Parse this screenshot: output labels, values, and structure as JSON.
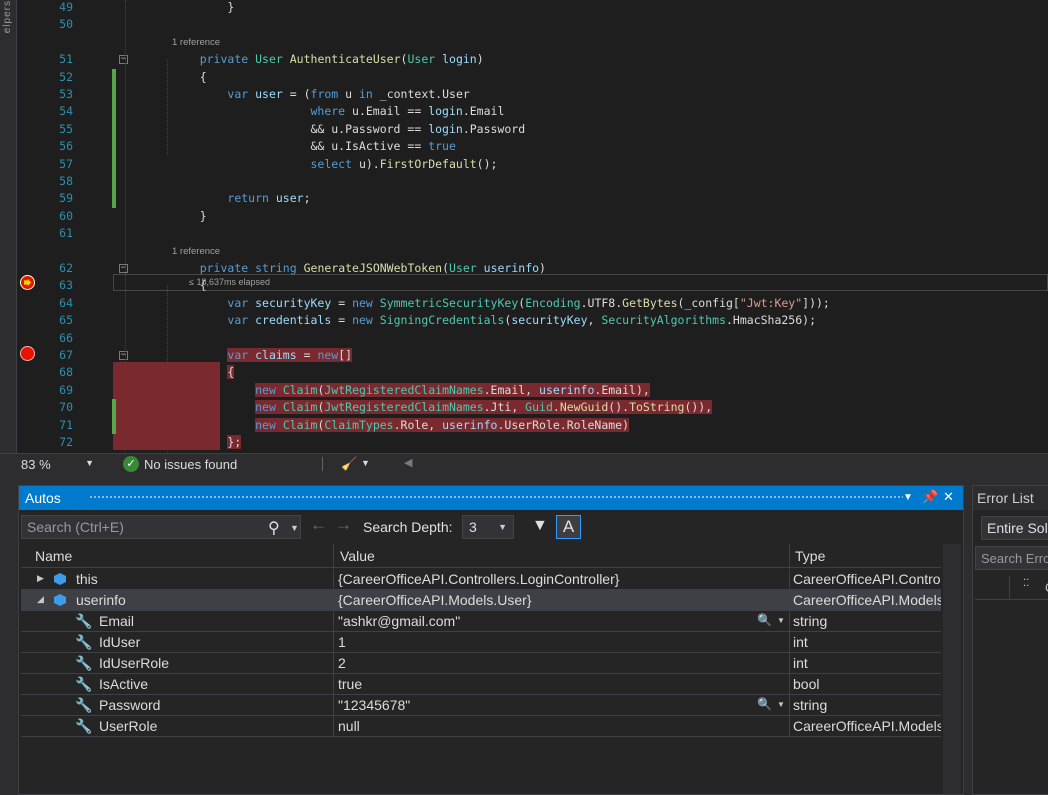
{
  "editor": {
    "left_strip_label": "elpers",
    "perf_tip": "≤ 18,637ms elapsed",
    "lines": [
      {
        "n": "49",
        "segs": [
          {
            "t": "        }",
            "c": ""
          }
        ]
      },
      {
        "n": "50",
        "segs": []
      },
      {
        "ref": "1 reference"
      },
      {
        "n": "51",
        "segs": [
          {
            "t": "    ",
            "c": ""
          },
          {
            "t": "private",
            "c": "kw"
          },
          {
            "t": " ",
            "c": ""
          },
          {
            "t": "User",
            "c": "ty"
          },
          {
            "t": " ",
            "c": ""
          },
          {
            "t": "AuthenticateUser",
            "c": "fn"
          },
          {
            "t": "(",
            "c": ""
          },
          {
            "t": "User",
            "c": "ty"
          },
          {
            "t": " ",
            "c": ""
          },
          {
            "t": "login",
            "c": "vr"
          },
          {
            "t": ")",
            "c": ""
          }
        ]
      },
      {
        "n": "52",
        "segs": [
          {
            "t": "    {",
            "c": ""
          }
        ]
      },
      {
        "n": "53",
        "segs": [
          {
            "t": "        ",
            "c": ""
          },
          {
            "t": "var",
            "c": "kw"
          },
          {
            "t": " ",
            "c": ""
          },
          {
            "t": "user",
            "c": "vr"
          },
          {
            "t": " = (",
            "c": ""
          },
          {
            "t": "from",
            "c": "kw"
          },
          {
            "t": " u ",
            "c": ""
          },
          {
            "t": "in",
            "c": "kw"
          },
          {
            "t": " _context.User",
            "c": ""
          }
        ]
      },
      {
        "n": "54",
        "segs": [
          {
            "t": "                    ",
            "c": ""
          },
          {
            "t": "where",
            "c": "kw"
          },
          {
            "t": " u.Email == ",
            "c": ""
          },
          {
            "t": "login",
            "c": "vr"
          },
          {
            "t": ".Email",
            "c": ""
          }
        ]
      },
      {
        "n": "55",
        "segs": [
          {
            "t": "                    && u.Password == ",
            "c": ""
          },
          {
            "t": "login",
            "c": "vr"
          },
          {
            "t": ".Password",
            "c": ""
          }
        ]
      },
      {
        "n": "56",
        "segs": [
          {
            "t": "                    && u.IsActive == ",
            "c": ""
          },
          {
            "t": "true",
            "c": "kw"
          }
        ]
      },
      {
        "n": "57",
        "segs": [
          {
            "t": "                    ",
            "c": ""
          },
          {
            "t": "select",
            "c": "kw"
          },
          {
            "t": " u).",
            "c": ""
          },
          {
            "t": "FirstOrDefault",
            "c": "fn"
          },
          {
            "t": "();",
            "c": ""
          }
        ]
      },
      {
        "n": "58",
        "segs": []
      },
      {
        "n": "59",
        "segs": [
          {
            "t": "        ",
            "c": ""
          },
          {
            "t": "return",
            "c": "kw"
          },
          {
            "t": " ",
            "c": ""
          },
          {
            "t": "user",
            "c": "vr"
          },
          {
            "t": ";",
            "c": ""
          }
        ]
      },
      {
        "n": "60",
        "segs": [
          {
            "t": "    }",
            "c": ""
          }
        ]
      },
      {
        "n": "61",
        "segs": []
      },
      {
        "ref": "1 reference"
      },
      {
        "n": "62",
        "segs": [
          {
            "t": "    ",
            "c": ""
          },
          {
            "t": "private",
            "c": "kw"
          },
          {
            "t": " ",
            "c": ""
          },
          {
            "t": "string",
            "c": "kw"
          },
          {
            "t": " ",
            "c": ""
          },
          {
            "t": "GenerateJSONWebToken",
            "c": "fn"
          },
          {
            "t": "(",
            "c": ""
          },
          {
            "t": "User",
            "c": "ty"
          },
          {
            "t": " ",
            "c": ""
          },
          {
            "t": "userinfo",
            "c": "vr"
          },
          {
            "t": ")",
            "c": ""
          }
        ]
      },
      {
        "n": "63",
        "segs": [
          {
            "t": "    {",
            "c": ""
          }
        ]
      },
      {
        "n": "64",
        "segs": [
          {
            "t": "        ",
            "c": ""
          },
          {
            "t": "var",
            "c": "kw"
          },
          {
            "t": " ",
            "c": ""
          },
          {
            "t": "securityKey",
            "c": "vr"
          },
          {
            "t": " = ",
            "c": ""
          },
          {
            "t": "new",
            "c": "kw"
          },
          {
            "t": " ",
            "c": ""
          },
          {
            "t": "SymmetricSecurityKey",
            "c": "ty"
          },
          {
            "t": "(",
            "c": ""
          },
          {
            "t": "Encoding",
            "c": "ty"
          },
          {
            "t": ".UTF8.",
            "c": ""
          },
          {
            "t": "GetBytes",
            "c": "fn"
          },
          {
            "t": "(_config[",
            "c": ""
          },
          {
            "t": "\"Jwt:Key\"",
            "c": "st"
          },
          {
            "t": "]));",
            "c": ""
          }
        ]
      },
      {
        "n": "65",
        "segs": [
          {
            "t": "        ",
            "c": ""
          },
          {
            "t": "var",
            "c": "kw"
          },
          {
            "t": " ",
            "c": ""
          },
          {
            "t": "credentials",
            "c": "vr"
          },
          {
            "t": " = ",
            "c": ""
          },
          {
            "t": "new",
            "c": "kw"
          },
          {
            "t": " ",
            "c": ""
          },
          {
            "t": "SigningCredentials",
            "c": "ty"
          },
          {
            "t": "(",
            "c": ""
          },
          {
            "t": "securityKey",
            "c": "vr"
          },
          {
            "t": ", ",
            "c": ""
          },
          {
            "t": "SecurityAlgorithms",
            "c": "ty"
          },
          {
            "t": ".HmacSha256);",
            "c": ""
          }
        ]
      },
      {
        "n": "66",
        "segs": []
      },
      {
        "n": "67",
        "segs": [
          {
            "t": "        ",
            "c": ""
          },
          {
            "t": "var",
            "c": "kw hl"
          },
          {
            "t": " ",
            "c": "hl"
          },
          {
            "t": "claims",
            "c": "vr hl"
          },
          {
            "t": " = ",
            "c": "hl"
          },
          {
            "t": "new",
            "c": "kw hl"
          },
          {
            "t": "[]",
            "c": "hl"
          }
        ]
      },
      {
        "n": "68",
        "segs": [
          {
            "t": "        ",
            "c": ""
          },
          {
            "t": "{",
            "c": "hl"
          }
        ]
      },
      {
        "n": "69",
        "segs": [
          {
            "t": "            ",
            "c": "hl0"
          },
          {
            "t": "new",
            "c": "kw hl"
          },
          {
            "t": " ",
            "c": "hl"
          },
          {
            "t": "Claim",
            "c": "ty hl"
          },
          {
            "t": "(",
            "c": "hl"
          },
          {
            "t": "JwtRegisteredClaimNames",
            "c": "ty hl"
          },
          {
            "t": ".Email, ",
            "c": "hl"
          },
          {
            "t": "userinfo",
            "c": "vr hl"
          },
          {
            "t": ".Email),",
            "c": "hl"
          }
        ]
      },
      {
        "n": "70",
        "segs": [
          {
            "t": "            ",
            "c": "hl0"
          },
          {
            "t": "new",
            "c": "kw hl"
          },
          {
            "t": " ",
            "c": "hl"
          },
          {
            "t": "Claim",
            "c": "ty hl"
          },
          {
            "t": "(",
            "c": "hl"
          },
          {
            "t": "JwtRegisteredClaimNames",
            "c": "ty hl"
          },
          {
            "t": ".Jti, ",
            "c": "hl"
          },
          {
            "t": "Guid",
            "c": "ty hl"
          },
          {
            "t": ".",
            "c": "hl"
          },
          {
            "t": "NewGuid",
            "c": "fn hl"
          },
          {
            "t": "().",
            "c": "hl"
          },
          {
            "t": "ToString",
            "c": "fn hl"
          },
          {
            "t": "()),",
            "c": "hl"
          }
        ]
      },
      {
        "n": "71",
        "segs": [
          {
            "t": "            ",
            "c": "hl0"
          },
          {
            "t": "new",
            "c": "kw hl"
          },
          {
            "t": " ",
            "c": "hl"
          },
          {
            "t": "Claim",
            "c": "ty hl"
          },
          {
            "t": "(",
            "c": "hl"
          },
          {
            "t": "ClaimTypes",
            "c": "ty hl"
          },
          {
            "t": ".Role, ",
            "c": "hl"
          },
          {
            "t": "userinfo",
            "c": "vr hl"
          },
          {
            "t": ".UserRole.RoleName)",
            "c": "hl"
          }
        ]
      },
      {
        "n": "72",
        "segs": [
          {
            "t": "        ",
            "c": ""
          },
          {
            "t": "};",
            "c": "hl"
          }
        ]
      }
    ]
  },
  "status": {
    "zoom": "83 %",
    "issues": "No issues found"
  },
  "autos": {
    "title": "Autos",
    "search_placeholder": "Search (Ctrl+E)",
    "depth_label": "Search Depth:",
    "depth_value": "3",
    "columns": {
      "name": "Name",
      "value": "Value",
      "type": "Type"
    },
    "rows": [
      {
        "name": "this",
        "value": "{CareerOfficeAPI.Controllers.LoginController}",
        "type": "CareerOfficeAPI.Controllers.LoginController",
        "kind": "object",
        "expander": "▶",
        "child": false
      },
      {
        "name": "userinfo",
        "value": "{CareerOfficeAPI.Models.User}",
        "type": "CareerOfficeAPI.Models.User",
        "kind": "object",
        "expander": "◢",
        "child": false,
        "selected": true
      },
      {
        "name": "Email",
        "value": "\"ashkr@gmail.com\"",
        "type": "string",
        "kind": "property",
        "child": true,
        "viewer": true
      },
      {
        "name": "IdUser",
        "value": "1",
        "type": "int",
        "kind": "property",
        "child": true
      },
      {
        "name": "IdUserRole",
        "value": "2",
        "type": "int",
        "kind": "property",
        "child": true
      },
      {
        "name": "IsActive",
        "value": "true",
        "type": "bool",
        "kind": "property",
        "child": true
      },
      {
        "name": "Password",
        "value": "\"12345678\"",
        "type": "string",
        "kind": "property",
        "child": true,
        "viewer": true
      },
      {
        "name": "UserRole",
        "value": "null",
        "type": "CareerOfficeAPI.Models.UserRole",
        "kind": "property",
        "child": true
      }
    ]
  },
  "errorlist": {
    "title": "Error List",
    "scope": "Entire Solution",
    "search": "Search Error List",
    "col_c": "C"
  }
}
